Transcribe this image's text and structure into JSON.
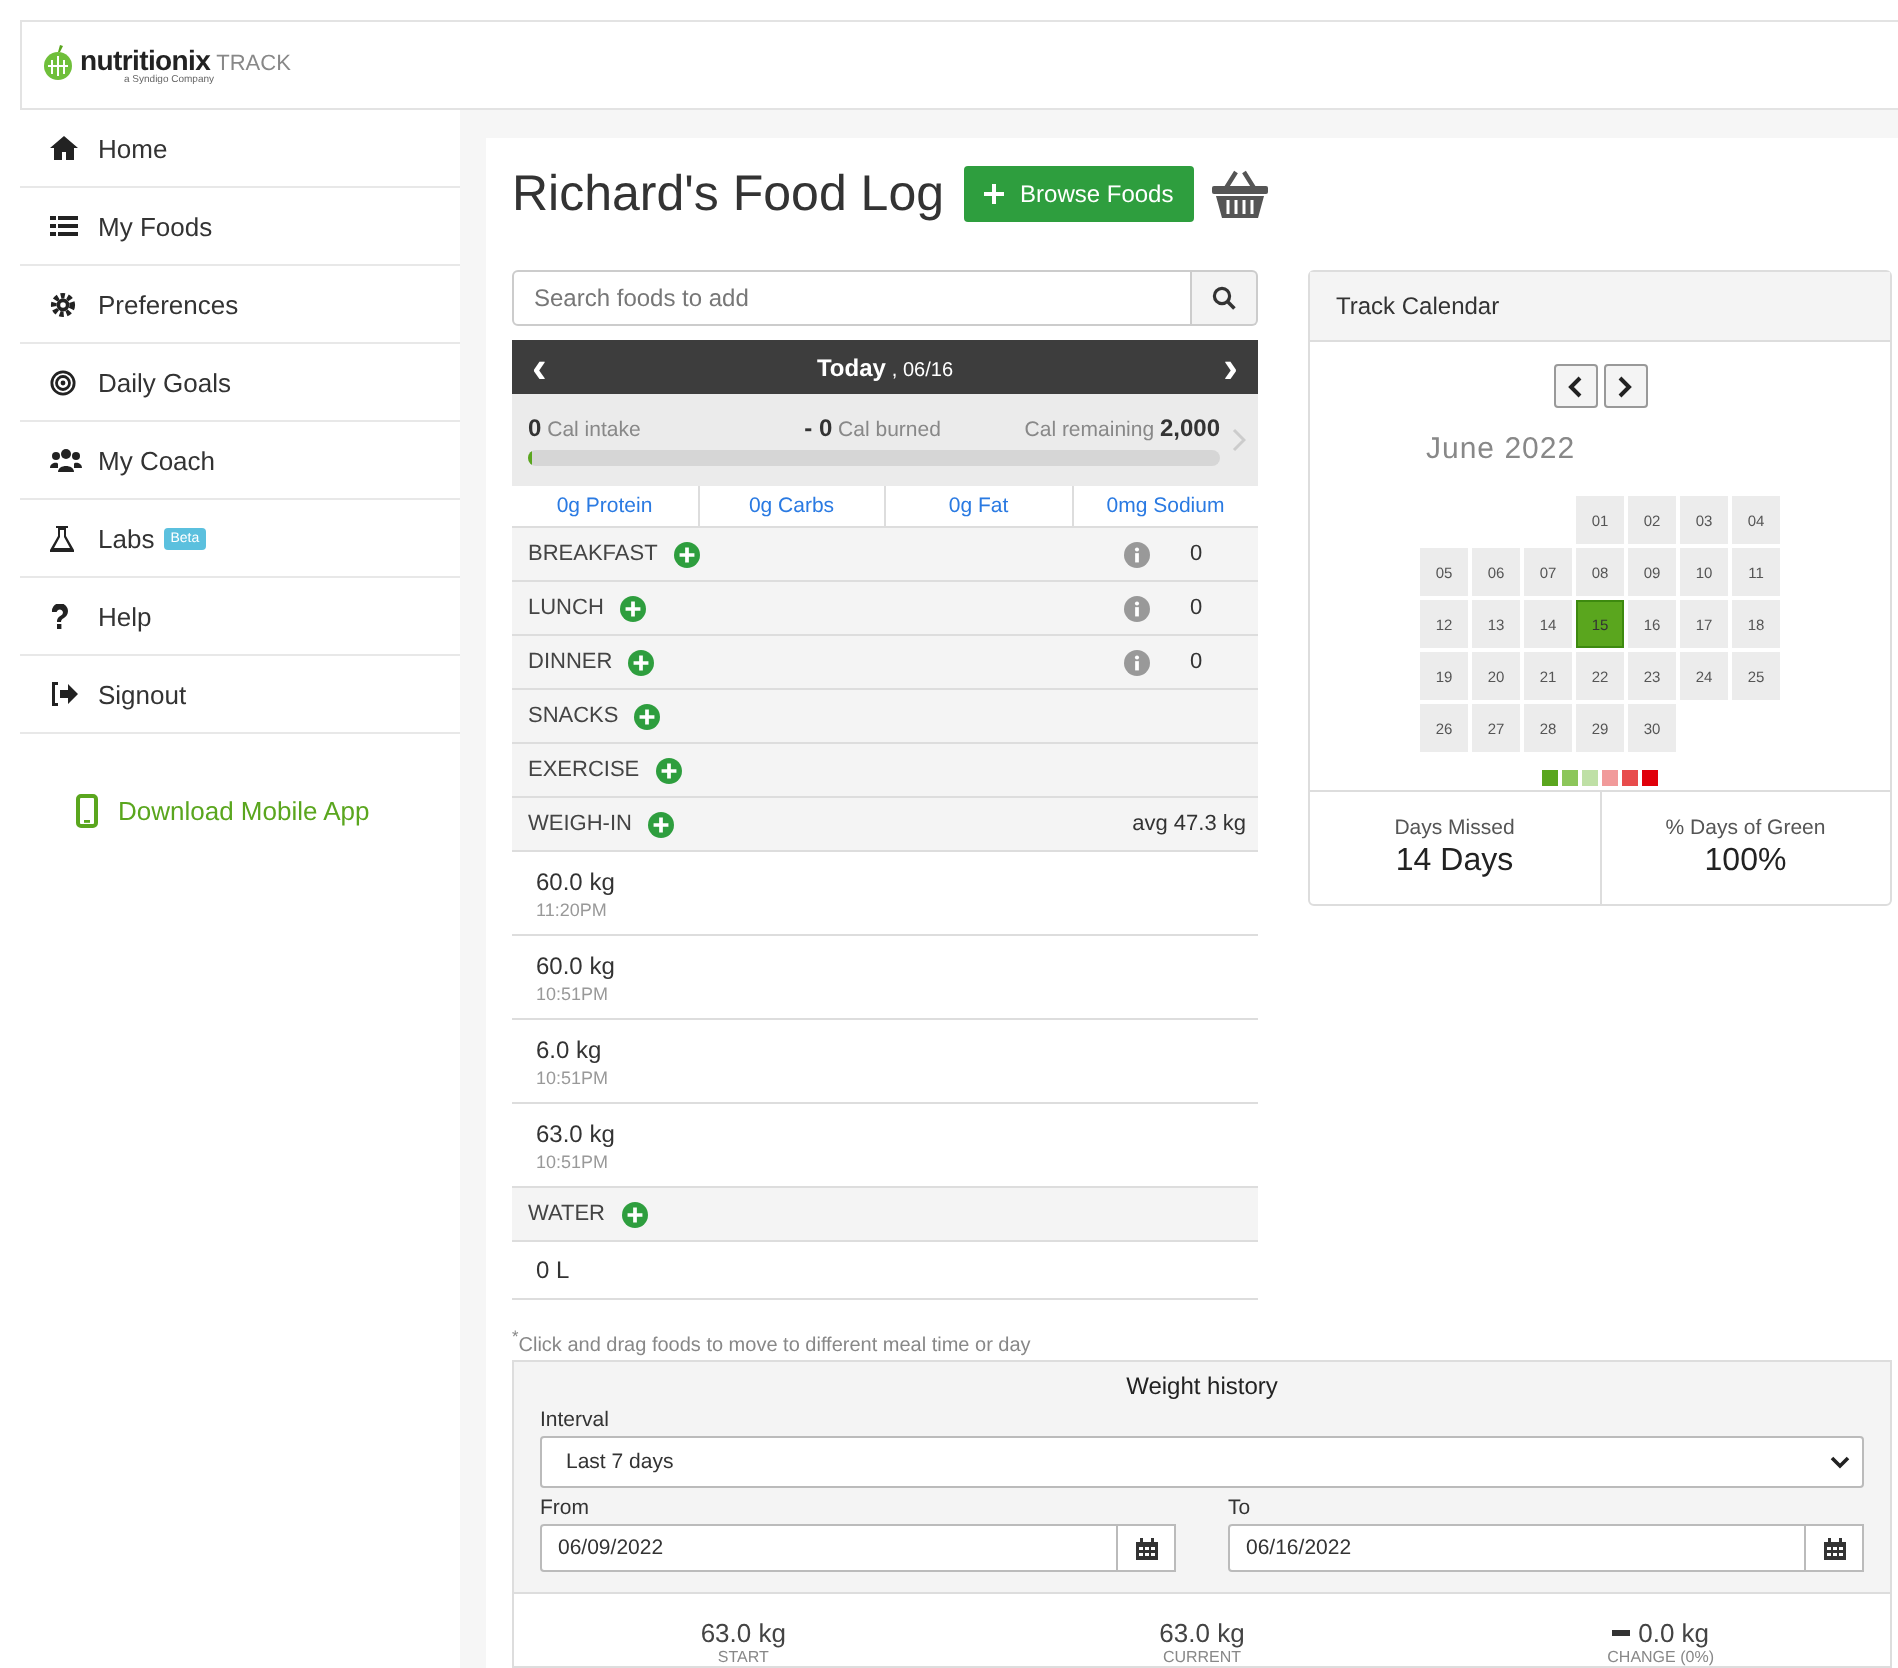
{
  "header": {
    "logo": "nutritionix",
    "logo_suffix": "TRACK",
    "tagline": "a Syndigo Company"
  },
  "sidebar": {
    "items": [
      {
        "label": "Home"
      },
      {
        "label": "My Foods"
      },
      {
        "label": "Preferences"
      },
      {
        "label": "Daily Goals"
      },
      {
        "label": "My Coach"
      },
      {
        "label": "Labs",
        "badge": "Beta"
      },
      {
        "label": "Help"
      },
      {
        "label": "Signout"
      }
    ],
    "download": "Download Mobile App"
  },
  "page": {
    "title": "Richard's Food Log",
    "browse_button": "Browse Foods"
  },
  "search": {
    "placeholder": "Search foods to add"
  },
  "date_bar": {
    "prev": "‹",
    "day": "Today",
    "date": ", 06/16",
    "next": "›"
  },
  "calories": {
    "intake_value": "0",
    "intake_label": "Cal intake",
    "burned_value": "- 0",
    "burned_label": "Cal burned",
    "remaining_label": "Cal remaining",
    "remaining_value": "2,000",
    "level": 0
  },
  "macros": [
    {
      "value": "0g",
      "label": "Protein"
    },
    {
      "value": "0g",
      "label": "Carbs"
    },
    {
      "value": "0g",
      "label": "Fat"
    },
    {
      "value": "0mg",
      "label": "Sodium"
    }
  ],
  "meals": [
    {
      "kind": "meal",
      "label": "BREAKFAST",
      "total": "0"
    },
    {
      "kind": "meal",
      "label": "LUNCH",
      "total": "0"
    },
    {
      "kind": "meal",
      "label": "DINNER",
      "total": "0"
    },
    {
      "kind": "plain",
      "label": "SNACKS"
    },
    {
      "kind": "plain",
      "label": "EXERCISE"
    },
    {
      "kind": "weigh",
      "label": "WEIGH-IN",
      "average": "avg 47.3 kg",
      "entries": [
        {
          "weight": "60.0 kg",
          "time": "11:20PM"
        },
        {
          "weight": "60.0 kg",
          "time": "10:51PM"
        },
        {
          "weight": "6.0 kg",
          "time": "10:51PM"
        },
        {
          "weight": "63.0 kg",
          "time": "10:51PM"
        }
      ]
    },
    {
      "kind": "water",
      "label": "WATER",
      "amount": "0 L"
    }
  ],
  "footnote": "$^{*}$Click and drag foods to move to different meal time or day",
  "calendar": {
    "title": "Track Calendar",
    "month": "June 2022",
    "days": [
      {
        "label": "01",
        "logged": false
      },
      {
        "label": "02",
        "logged": false
      },
      {
        "label": "03",
        "logged": false
      },
      {
        "label": "04",
        "logged": false
      },
      {
        "label": "05",
        "logged": false
      },
      {
        "label": "06",
        "logged": false
      },
      {
        "label": "07",
        "logged": false
      },
      {
        "label": "08",
        "logged": false
      },
      {
        "label": "09",
        "logged": false
      },
      {
        "label": "10",
        "logged": false
      },
      {
        "label": "11",
        "logged": false
      },
      {
        "label": "12",
        "logged": false
      },
      {
        "label": "13",
        "logged": false
      },
      {
        "label": "14",
        "logged": false
      },
      {
        "label": "15",
        "logged": true
      },
      {
        "label": "16",
        "logged": false
      },
      {
        "label": "17",
        "logged": false
      },
      {
        "label": "18",
        "logged": false
      },
      {
        "label": "19",
        "logged": false
      },
      {
        "label": "20",
        "logged": false
      },
      {
        "label": "21",
        "logged": false
      },
      {
        "label": "22",
        "logged": false
      },
      {
        "label": "23",
        "logged": false
      },
      {
        "label": "24",
        "logged": false
      },
      {
        "label": "25",
        "logged": false
      },
      {
        "label": "26",
        "logged": false
      },
      {
        "label": "27",
        "logged": false
      },
      {
        "label": "28",
        "logged": false
      },
      {
        "label": "29",
        "logged": false
      },
      {
        "label": "30",
        "logged": false
      }
    ],
    "legend": [
      {
        "color": "#5aa61e"
      },
      {
        "color": "#8cc65a"
      },
      {
        "color": "#bfe0a6"
      },
      {
        "color": "#f19a9a"
      },
      {
        "color": "#e84c4c"
      },
      {
        "color": "#e0000a"
      }
    ],
    "stats": [
      {
        "label": "Days Missed",
        "value": "14 Days"
      },
      {
        "label": "% Days of Green",
        "value": "100%"
      }
    ]
  },
  "weight_history": {
    "title": "Weight history",
    "interval_label": "Interval",
    "interval": "Last 7 days",
    "from_label": "From",
    "from": "06/09/2022",
    "to_label": "To",
    "to": "06/16/2022",
    "summary": [
      {
        "value": "63.0 kg",
        "label": "START"
      },
      {
        "value": "63.0 kg",
        "label": "CURRENT"
      },
      {
        "value": "0.0 kg",
        "label": "CHANGE (0%)",
        "dash": true
      }
    ]
  }
}
